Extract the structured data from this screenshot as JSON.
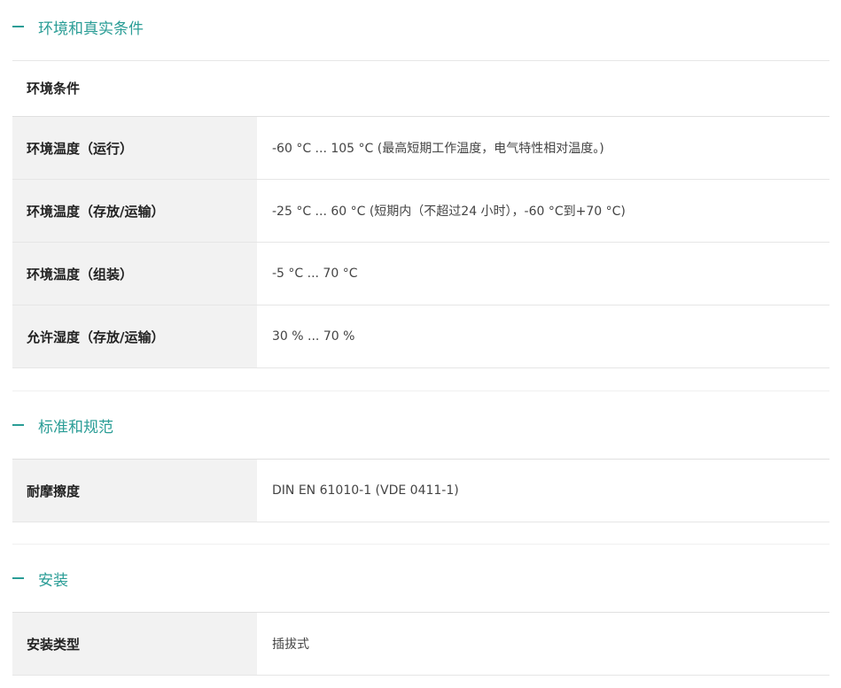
{
  "sections": [
    {
      "title": "环境和真实条件",
      "group_title": "环境条件",
      "rows": [
        {
          "label": "环境温度（运行）",
          "value": "-60 °C ... 105 °C (最高短期工作温度，电气特性相对温度。)"
        },
        {
          "label": "环境温度（存放/运输）",
          "value": "-25 °C ... 60 °C (短期内（不超过24  小时），-60 °C到+70 °C)"
        },
        {
          "label": "环境温度（组装）",
          "value": "-5 °C ... 70 °C"
        },
        {
          "label": "允许湿度（存放/运输）",
          "value": "30 % ... 70 %"
        }
      ]
    },
    {
      "title": "标准和规范",
      "rows": [
        {
          "label": "耐摩擦度",
          "value": "DIN EN 61010-1 (VDE 0411-1)"
        }
      ]
    },
    {
      "title": "安装",
      "rows": [
        {
          "label": "安装类型",
          "value": "插拔式"
        }
      ]
    }
  ],
  "colors": {
    "accent": "#2a9d96",
    "label_bg": "#f2f2f2",
    "border": "#e6e6e6"
  }
}
